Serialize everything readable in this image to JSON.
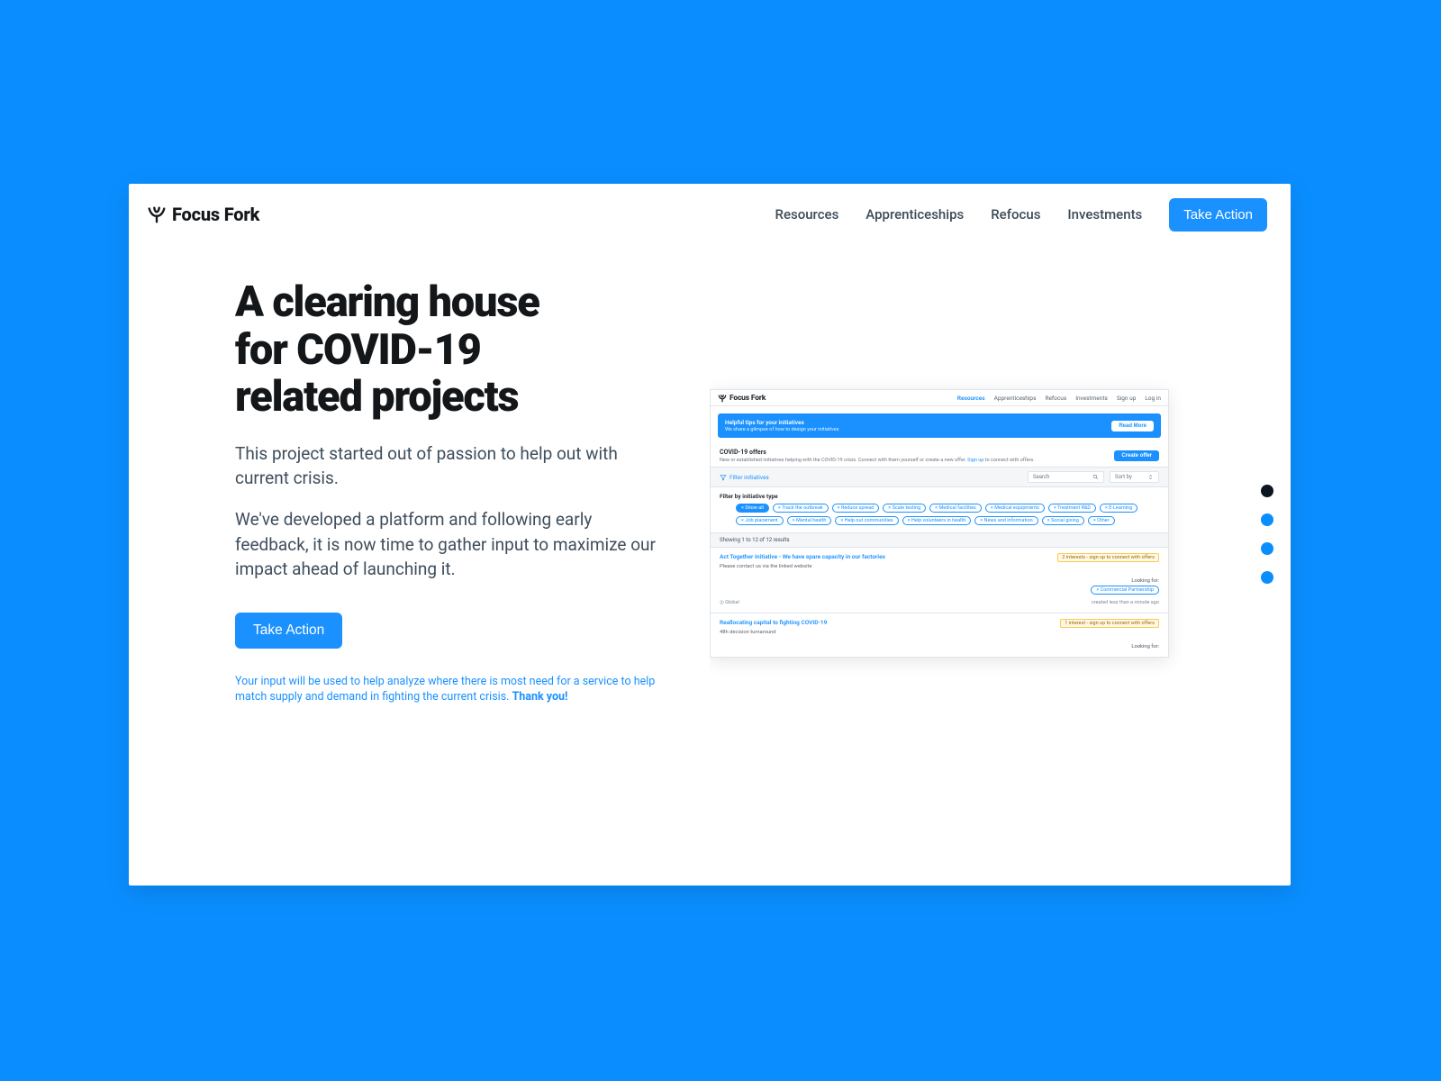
{
  "brand": "Focus Fork",
  "nav": {
    "items": [
      {
        "label": "Resources"
      },
      {
        "label": "Apprenticeships"
      },
      {
        "label": "Refocus"
      },
      {
        "label": "Investments"
      }
    ],
    "cta": "Take Action"
  },
  "hero": {
    "headline_l1": "A clearing house",
    "headline_l2": "for COVID-19",
    "headline_l3": "related projects",
    "para1": "This project started out of passion to help out with current crisis.",
    "para2": "We've developed a platform and following early feedback, it is now time to gather input to maximize our impact ahead of launching it.",
    "cta": "Take Action",
    "footnote_a": "Your input will be used to help analyze where there is most need for a service to help match supply and demand in fighting the current crisis. ",
    "footnote_b": "Thank you!"
  },
  "preview": {
    "brand": "Focus Fork",
    "nav": [
      "Resources",
      "Apprenticeships",
      "Refocus",
      "Investments",
      "Sign up",
      "Log in"
    ],
    "banner": {
      "title": "Helpful tips for your initiatives",
      "sub": "We share a glimpse of how to design your initiatives",
      "cta": "Read More"
    },
    "section": {
      "title": "COVID-19 offers",
      "sub_a": "New or established initiatives helping with the COVID-19 crisis. Connect with them yourself or create a new offer. ",
      "sub_b": "Sign up",
      "sub_c": " to connect with offers.",
      "cta": "Create offer"
    },
    "toolbar": {
      "filter": "Filter initiatives",
      "search": "Search",
      "sort": "Sort by"
    },
    "filter": {
      "title": "Filter by initiative type",
      "chips": [
        "Show all",
        "Track the outbreak",
        "Reduce spread",
        "Scale testing",
        "Medical facilities",
        "Medical equipments",
        "Treatment R&D",
        "E-Learning",
        "Job placement",
        "Mental health",
        "Help out communities",
        "Help volunteers in health",
        "News and information",
        "Social giving",
        "Other"
      ]
    },
    "result_bar": "Showing 1 to 12 of 12 results",
    "items": [
      {
        "title": "Act Together Initiative - We have spare capacity in our factories",
        "sub": "Please contact us via the linked website",
        "badge": "2 interests - sign up to connect with offers",
        "looking": "Looking for:",
        "look_chip": "× Commercial Partnership",
        "foot_left": "◎  Global",
        "foot_right": "created less than a minute ago"
      },
      {
        "title": "Reallocating capital to fighting COVID-19",
        "sub": "48h decision turnaround",
        "badge": "1 interest - sign up to connect with offers",
        "looking": "Looking for:"
      }
    ]
  },
  "dots": {
    "count": 4,
    "active": 0
  }
}
